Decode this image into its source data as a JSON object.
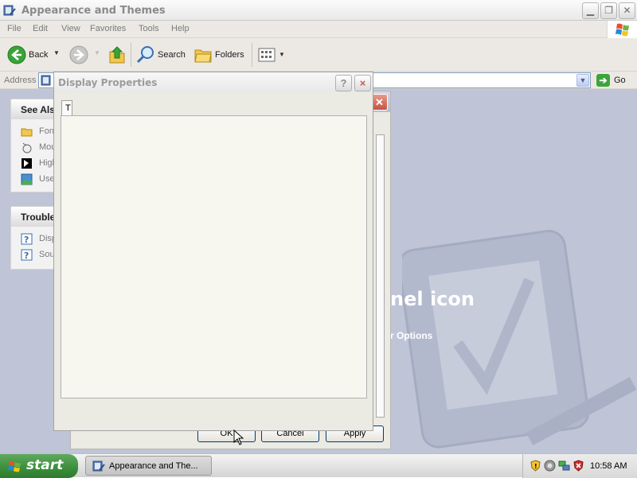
{
  "window": {
    "title": "Appearance and Themes",
    "minimize": "0",
    "maximize": "1",
    "close": "r"
  },
  "menu": [
    "File",
    "Edit",
    "View",
    "Favorites",
    "Tools",
    "Help"
  ],
  "toolbar": {
    "back_label": "Back",
    "search_label": "Search",
    "folders_label": "Folders"
  },
  "address": {
    "label": "Address",
    "value": "",
    "go_label": "Go"
  },
  "see_also": {
    "title": "See Also",
    "items": [
      {
        "label": "Fonts",
        "icon": "fonts-folder-icon"
      },
      {
        "label": "Mouse Pointers",
        "icon": "mouse-icon"
      },
      {
        "label": "High Contrast",
        "icon": "high-contrast-icon"
      },
      {
        "label": "User Account Picture",
        "icon": "user-picture-icon"
      }
    ]
  },
  "troubleshooters": {
    "title": "Troubleshooters",
    "items": [
      {
        "label": "Display",
        "icon": "help-icon"
      },
      {
        "label": "Sound",
        "icon": "help-icon"
      }
    ]
  },
  "watermark": {
    "text": "nel icon",
    "sub": "r Options"
  },
  "back_dialog": {
    "ok": "OK",
    "cancel": "Cancel",
    "apply": "Apply"
  },
  "dialog": {
    "title": "Display Properties",
    "tab_stub": "T",
    "help": "?",
    "close": "×"
  },
  "taskbar": {
    "start_label": "start",
    "task_label": "Appearance and The...",
    "clock": "10:58 AM"
  },
  "colors": {
    "content_bg": "#bfc5d7",
    "start_green": "#3b8e3b"
  }
}
